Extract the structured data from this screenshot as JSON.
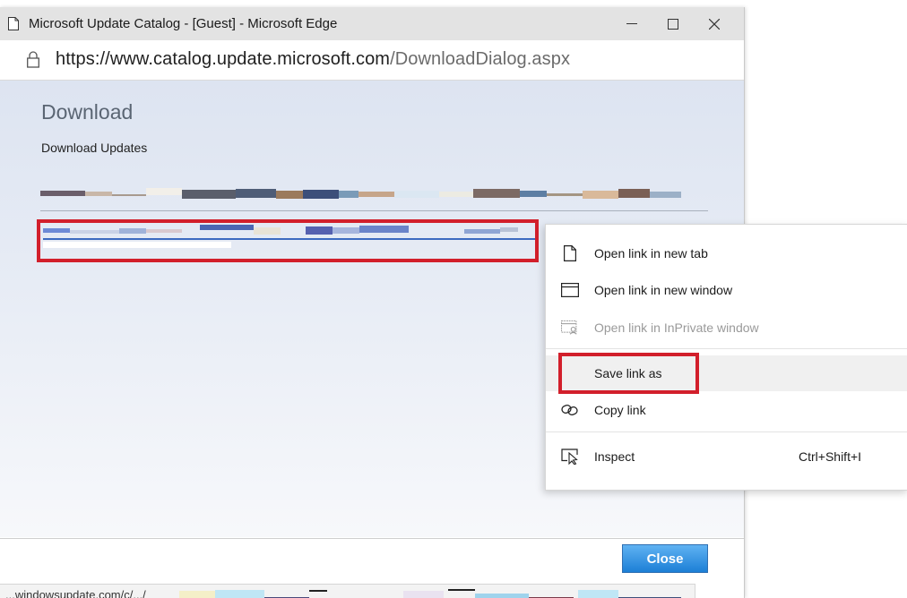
{
  "window": {
    "title": "Microsoft Update Catalog - [Guest] - Microsoft Edge",
    "controls": {
      "minimize": "—",
      "maximize": "☐",
      "close": "✕"
    }
  },
  "address": {
    "url_host": "https://www.catalog.update.microsoft.com",
    "url_path": "/DownloadDialog.aspx"
  },
  "dialog": {
    "title": "Download",
    "subtitle": "Download Updates",
    "close_button": "Close"
  },
  "status_bar": {
    "text": "...windowsupdate.com/c/.../"
  },
  "context_menu": {
    "items": [
      {
        "label": "Open link in new tab",
        "icon": "new-tab-icon",
        "enabled": true
      },
      {
        "label": "Open link in new window",
        "icon": "new-window-icon",
        "enabled": true
      },
      {
        "label": "Open link in InPrivate window",
        "icon": "inprivate-window-icon",
        "enabled": false
      },
      {
        "label": "Save link as",
        "icon": "",
        "enabled": true
      },
      {
        "label": "Copy link",
        "icon": "link-icon",
        "enabled": true
      },
      {
        "label": "Inspect",
        "icon": "inspect-icon",
        "enabled": true,
        "shortcut": "Ctrl+Shift+I"
      }
    ]
  },
  "colors": {
    "highlight": "#d21f2b",
    "close_button": "#1c7fd6",
    "titlebar": "#e3e3e3"
  }
}
